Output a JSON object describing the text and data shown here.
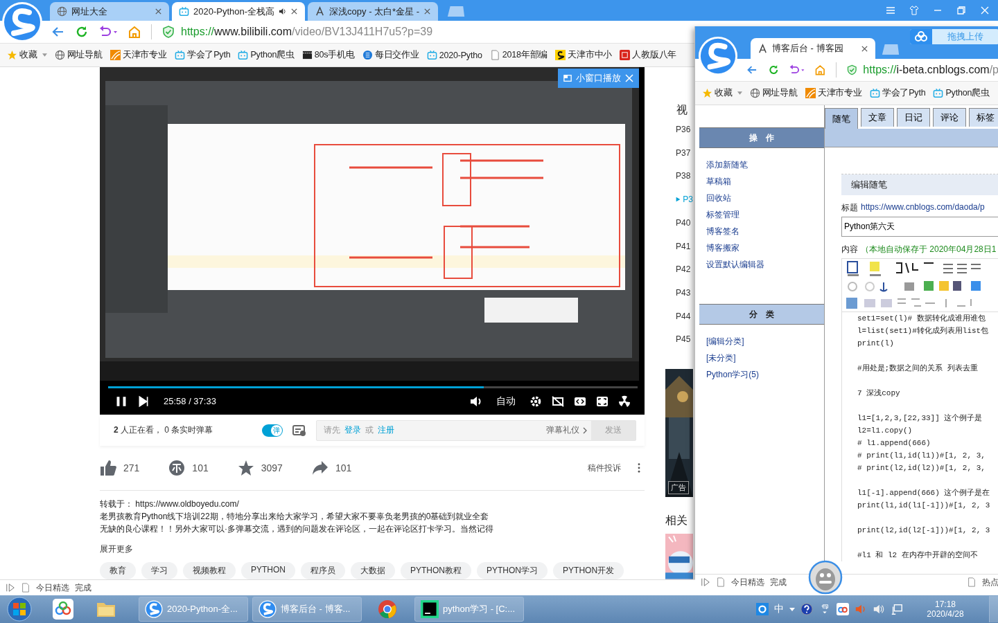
{
  "main_window": {
    "tabs": [
      {
        "title": "网址大全",
        "selected": false,
        "kind": "globe",
        "audio": false
      },
      {
        "title": "2020-Python-全栈高",
        "selected": true,
        "kind": "tv",
        "audio": true
      },
      {
        "title": "深浅copy - 太白*金星 -",
        "selected": false,
        "kind": "blog",
        "audio": false
      }
    ],
    "address": {
      "scheme": "https://",
      "host": "www.bilibili.com",
      "path": "/video/BV13J411H7u5?p=39"
    },
    "bookmarks": [
      {
        "label": "收藏",
        "kind": "star"
      },
      {
        "label": "网址导航",
        "kind": "globe"
      },
      {
        "label": "天津市专业",
        "kind": "stripes"
      },
      {
        "label": "学会了Pyth",
        "kind": "tv"
      },
      {
        "label": "Python爬虫",
        "kind": "tv"
      },
      {
        "label": "80s手机电",
        "kind": "film"
      },
      {
        "label": "每日交作业",
        "kind": "circle"
      },
      {
        "label": "2020-Pytho",
        "kind": "tv"
      },
      {
        "label": "2018年部编",
        "kind": "page"
      },
      {
        "label": "天津市中小",
        "kind": "slogo"
      },
      {
        "label": "人教版八年",
        "kind": "square"
      }
    ],
    "player": {
      "mini_play": "小窗口播放",
      "time": "25:58 / 37:33",
      "level": 0.71,
      "auto": "自动"
    },
    "danmaku": {
      "viewers": "**2** 人正在看， 0 条实时弹幕",
      "toggle": {
        "label": "弹",
        "on": true
      },
      "prompt": "请先",
      "login": "登录",
      "or": "或",
      "register": "注册",
      "etiquette": "弹幕礼仪",
      "send": "发送"
    },
    "actions": [
      {
        "kind": "like",
        "count": "271"
      },
      {
        "kind": "coin",
        "count": "101"
      },
      {
        "kind": "favorite",
        "count": "3097"
      },
      {
        "kind": "share",
        "count": "101"
      }
    ],
    "report": "稿件投诉",
    "description": [
      "转载于： https://www.oldboyedu.com/",
      "老男孩教育Python线下培训22期，特地分享出来给大家学习，希望大家不要辜负老男孩的0基础到就业全套",
      "无缺的良心课程！！另外大家可以·多弹幕交流，遇到的问题发在评论区，一起在评论区打卡学习。当然记得"
    ],
    "expand": "展开更多",
    "tags": [
      "教育",
      "学习",
      "视频教程",
      "PYTHON",
      "程序员",
      "大数据",
      "PYTHON教程",
      "PYTHON学习",
      "PYTHON开发"
    ],
    "playlist": {
      "heading": "视",
      "items": [
        {
          "label": "P36",
          "selected": false
        },
        {
          "label": "P37",
          "selected": false
        },
        {
          "label": "P38",
          "selected": false
        },
        {
          "label": "P3",
          "selected": true
        },
        {
          "label": "P40",
          "selected": false
        },
        {
          "label": "P41",
          "selected": false
        },
        {
          "label": "P42",
          "selected": false
        },
        {
          "label": "P43",
          "selected": false
        },
        {
          "label": "P44",
          "selected": false
        },
        {
          "label": "P45",
          "selected": false
        }
      ]
    },
    "ad_badge": "广告",
    "related": "相关",
    "status_bar": [
      "今日精选",
      "完成"
    ]
  },
  "blog_window": {
    "tab": "博客后台 - 博客园",
    "upload": "拖拽上传",
    "address": {
      "scheme": "https://",
      "host": "i-beta.cnblogs.com",
      "path": "/p"
    },
    "bookmarks": [
      {
        "label": "收藏",
        "kind": "star"
      },
      {
        "label": "网址导航",
        "kind": "globe"
      },
      {
        "label": "天津市专业",
        "kind": "stripes"
      },
      {
        "label": "学会了Pyth",
        "kind": "tv"
      },
      {
        "label": "Python爬虫",
        "kind": "tv"
      }
    ],
    "page_tabs": [
      {
        "label": "随笔",
        "selected": true
      },
      {
        "label": "文章",
        "selected": false
      },
      {
        "label": "日记",
        "selected": false
      },
      {
        "label": "评论",
        "selected": false
      },
      {
        "label": "标签",
        "selected": false
      }
    ],
    "sidebar": [
      {
        "heading": "操　作",
        "dark": true,
        "links": [
          "添加新随笔",
          "草稿箱",
          "回收站",
          "标签管理",
          "博客签名",
          "博客搬家",
          "设置默认编辑器"
        ]
      },
      {
        "heading": "分　类",
        "dark": false,
        "links": [
          "[编辑分类]",
          "[未分类]",
          "Python学习(5)"
        ]
      }
    ],
    "editor": {
      "heading": "编辑随笔",
      "title_label": "标题",
      "title_link": "https://www.cnblogs.com/daoda/p",
      "title_value": "Python第六天",
      "content_label": "内容",
      "autosave": "（本地自动保存于 2020年04月28日1",
      "paragraphs": [
        [
          "set1=set(l)# 数据转化成谁用谁包",
          "l=list(set1)#转化成列表用list包",
          "print(l)"
        ],
        [
          "#用处是;数据之间的关系  列表去重"
        ],
        [
          "7   深浅copy"
        ],
        [
          "l1=[1,2,3,[22,33]]    这个例子是",
          "l2=l1.copy()",
          "# l1.append(666)",
          "# print(l1,id(l1))#[1, 2, 3,",
          "# print(l2,id(l2))#[1, 2, 3,"
        ],
        [
          "l1[-1].append(666) 这个例子是在",
          "print(l1,id(l1[-1]))#[1, 2, 3"
        ],
        [
          "print(l2,id(l2[-1]))#[1, 2, 3"
        ],
        [
          "#l1   和   l2 在内存中开辟的空间不"
        ]
      ]
    },
    "status_bar": [
      "今日精选",
      "完成",
      "热点"
    ]
  },
  "taskbar": {
    "tasks": [
      {
        "label": "2020-Python-全...",
        "kind": "browser"
      },
      {
        "label": "博客后台 - 博客...",
        "kind": "browser"
      },
      {
        "kind": "chrome"
      },
      {
        "label": "python学习 - [C:...",
        "kind": "pycharm"
      }
    ],
    "ime": "中",
    "time": "17:18",
    "date": "2020/4/28"
  }
}
